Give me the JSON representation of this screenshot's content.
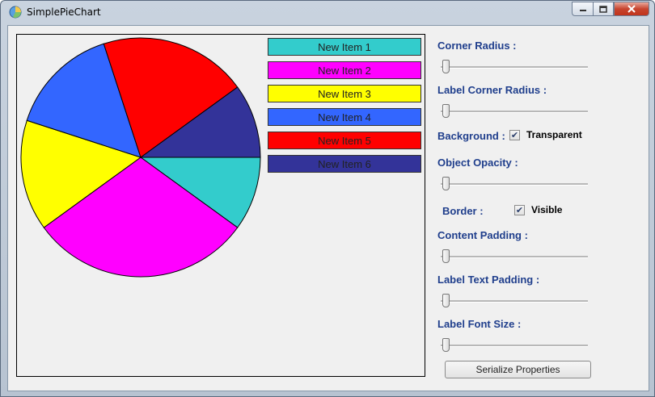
{
  "window": {
    "title": "SimplePieChart"
  },
  "chart_data": {
    "type": "pie",
    "slices": [
      {
        "label": "New Item 1",
        "value": 10,
        "color": "#33cccc"
      },
      {
        "label": "New Item 2",
        "value": 30,
        "color": "#ff00ff"
      },
      {
        "label": "New Item 3",
        "value": 15,
        "color": "#ffff00"
      },
      {
        "label": "New Item 4",
        "value": 15,
        "color": "#3366ff"
      },
      {
        "label": "New Item 5",
        "value": 20,
        "color": "#ff0000"
      },
      {
        "label": "New Item 6",
        "value": 10,
        "color": "#333399"
      }
    ]
  },
  "properties": {
    "corner_radius": {
      "label": "Corner Radius :",
      "value": 0
    },
    "label_corner_radius": {
      "label": "Label Corner Radius :",
      "value": 0
    },
    "background": {
      "label": "Background :",
      "checkbox_label": "Transparent",
      "checked": true
    },
    "object_opacity": {
      "label": "Object Opacity :",
      "value": 0
    },
    "border": {
      "label": "Border :",
      "checkbox_label": "Visible",
      "checked": true
    },
    "content_padding": {
      "label": "Content Padding :",
      "value": 0
    },
    "label_text_padding": {
      "label": "Label Text Padding :",
      "value": 0
    },
    "label_font_size": {
      "label": "Label Font Size :",
      "value": 0
    }
  },
  "buttons": {
    "serialize": "Serialize Properties"
  }
}
